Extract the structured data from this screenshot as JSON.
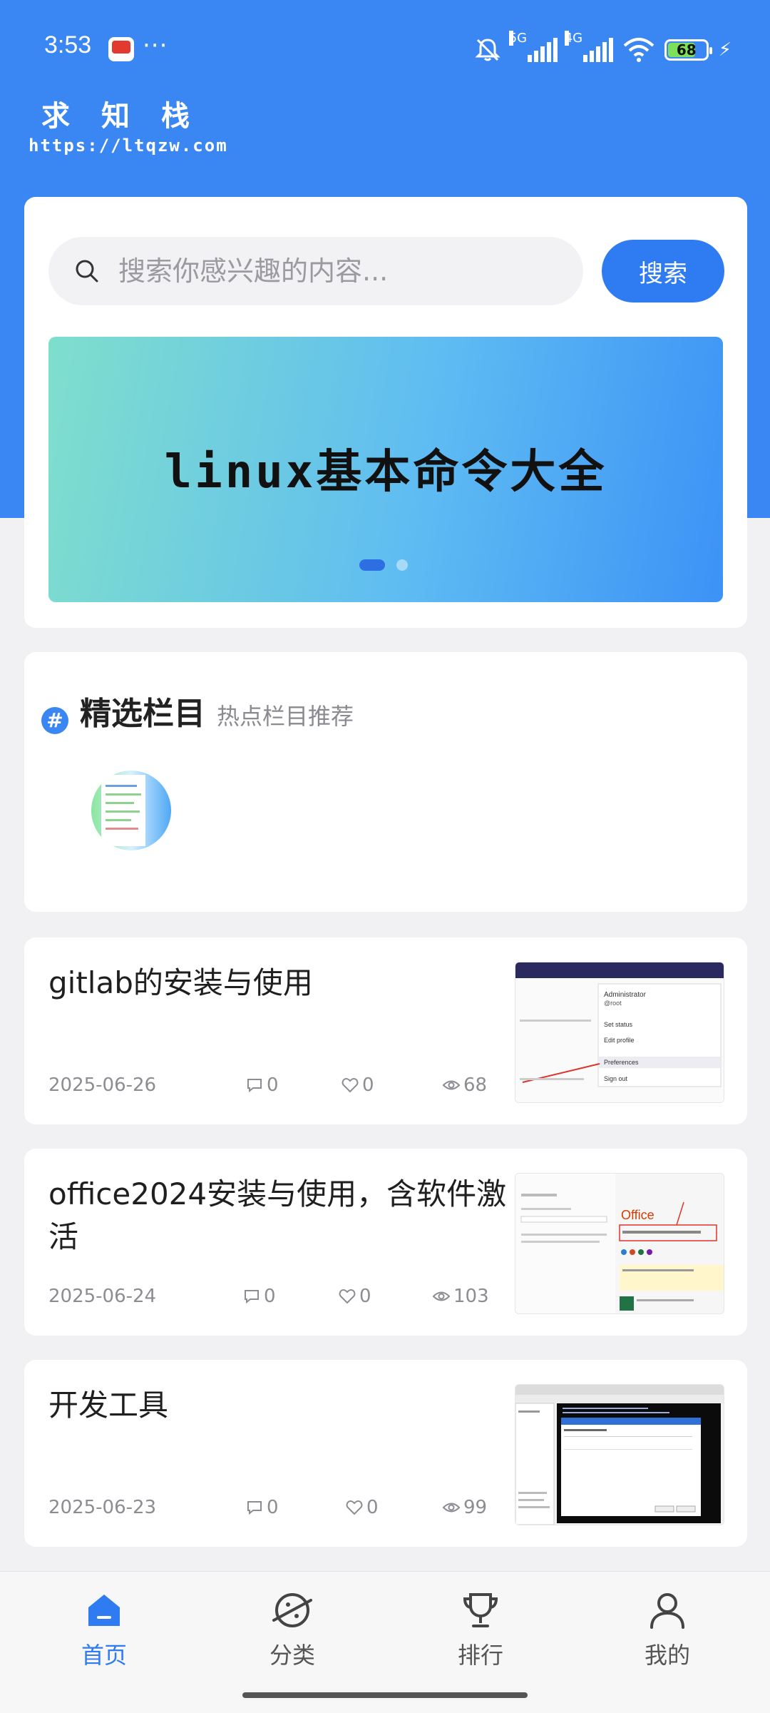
{
  "status_bar": {
    "time": "3:53",
    "more": "···",
    "net1": "5G",
    "net2": "4G",
    "battery": "68"
  },
  "logo": {
    "name": "求知栈",
    "url": "https://ltqzw.com"
  },
  "search": {
    "placeholder": "搜索你感兴趣的内容...",
    "button_label": "搜索"
  },
  "banner": {
    "title": "linux基本命令大全",
    "slide_count": 2,
    "active_slide": 1
  },
  "featured": {
    "title": "精选栏目",
    "subtitle": "热点栏目推荐"
  },
  "articles": [
    {
      "title": "gitlab的安装与使用",
      "date": "2025-06-26",
      "comments": "0",
      "likes": "0",
      "views": "68"
    },
    {
      "title": "office2024安装与使用，含软件激活",
      "date": "2025-06-24",
      "comments": "0",
      "likes": "0",
      "views": "103"
    },
    {
      "title": "开发工具",
      "date": "2025-06-23",
      "comments": "0",
      "likes": "0",
      "views": "99"
    }
  ],
  "thumb_text": {
    "admin": "Administrator",
    "root": "@root",
    "set_status": "Set status",
    "edit_profile": "Edit profile",
    "preferences": "Preferences",
    "sign_out": "Sign out",
    "office": "Office"
  },
  "bottom_nav": {
    "items": [
      {
        "label": "首页",
        "icon": "home-icon"
      },
      {
        "label": "分类",
        "icon": "planet-icon"
      },
      {
        "label": "排行",
        "icon": "trophy-icon"
      },
      {
        "label": "我的",
        "icon": "user-icon"
      }
    ],
    "active_index": 0
  },
  "colors": {
    "brand_blue": "#3a86f2",
    "button_blue": "#2f7bf1",
    "background": "#f1f1f3"
  }
}
